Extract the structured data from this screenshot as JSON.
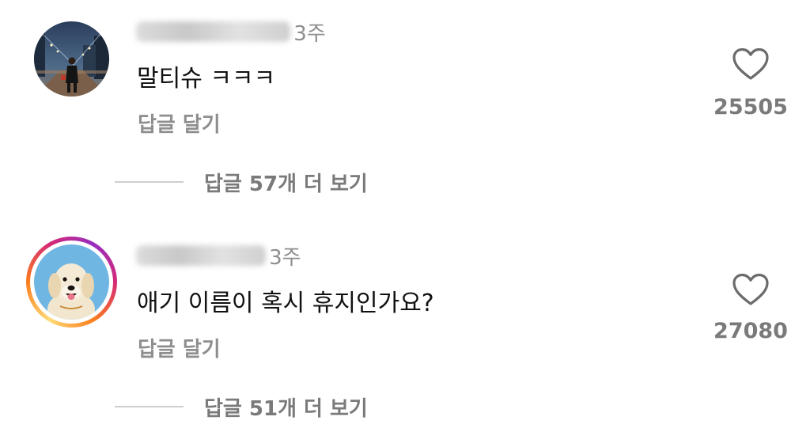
{
  "comments": [
    {
      "username": "seoulnight_tk",
      "time": "3주",
      "text": "말티슈 ㅋㅋㅋ",
      "reply_label": "답글 달기",
      "likes": "25505",
      "view_replies_label": "답글 57개 더 보기",
      "has_story": false,
      "avatar": "night-city-person-photo"
    },
    {
      "username": "raedog_fan",
      "time": "3주",
      "text": "애기 이름이 혹시 휴지인가요?",
      "reply_label": "답글 달기",
      "likes": "27080",
      "view_replies_label": "답글 51개 더 보기",
      "has_story": true,
      "avatar": "golden-retriever-photo"
    }
  ],
  "icons": {
    "like": "heart-outline-icon"
  },
  "colors": {
    "text_primary": "#111111",
    "text_secondary": "#8e8e8e",
    "story_ring_start": "#feda75",
    "story_ring_end": "#962fbf"
  }
}
